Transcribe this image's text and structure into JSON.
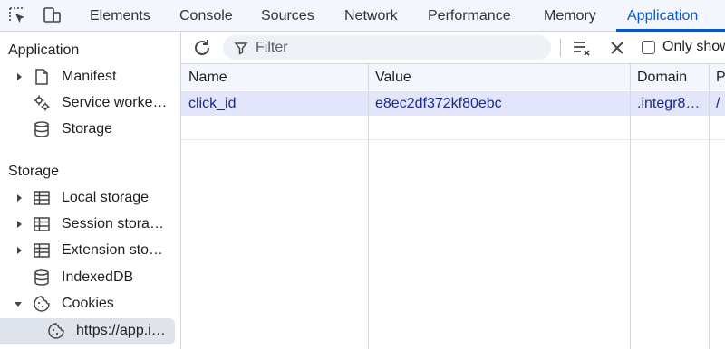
{
  "toolbar_icons": {
    "inspect": "inspect-element-icon",
    "device": "device-toolbar-icon"
  },
  "tabs": [
    {
      "label": "Elements",
      "active": false
    },
    {
      "label": "Console",
      "active": false
    },
    {
      "label": "Sources",
      "active": false
    },
    {
      "label": "Network",
      "active": false
    },
    {
      "label": "Performance",
      "active": false
    },
    {
      "label": "Memory",
      "active": false
    },
    {
      "label": "Application",
      "active": true
    }
  ],
  "sidebar": {
    "application_section": {
      "title": "Application",
      "items": [
        {
          "label": "Manifest",
          "icon": "document-icon",
          "expandable": true
        },
        {
          "label": "Service worke…",
          "icon": "gears-icon",
          "expandable": false
        },
        {
          "label": "Storage",
          "icon": "database-icon",
          "expandable": false
        }
      ]
    },
    "storage_section": {
      "title": "Storage",
      "items": [
        {
          "label": "Local storage",
          "icon": "table-icon",
          "expandable": true
        },
        {
          "label": "Session stora…",
          "icon": "table-icon",
          "expandable": true
        },
        {
          "label": "Extension sto…",
          "icon": "table-icon",
          "expandable": true
        },
        {
          "label": "IndexedDB",
          "icon": "database-icon",
          "expandable": false
        },
        {
          "label": "Cookies",
          "icon": "cookie-icon",
          "expanded": true
        },
        {
          "label": "https://app.i…",
          "icon": "cookie-icon",
          "selected": true
        }
      ]
    }
  },
  "cookie_toolbar": {
    "refresh_icon": "refresh-icon",
    "filter_placeholder": "Filter",
    "filter_value": "",
    "clear_filtered_icon": "clear-filtered-icon",
    "delete_icon": "close-icon",
    "only_show_label": "Only show",
    "only_show_checked": false
  },
  "table": {
    "columns": [
      "Name",
      "Value",
      "Domain",
      "P."
    ],
    "rows": [
      {
        "name": "click_id",
        "value": "e8ec2df372kf80ebc",
        "domain": ".integr8…",
        "path": "/",
        "selected": true
      }
    ]
  },
  "colors": {
    "accent": "#0b57d0",
    "selected_row": "#e3e6fb",
    "header_bg": "#f3f6fc",
    "selected_sidebar": "#dfe3eb"
  }
}
